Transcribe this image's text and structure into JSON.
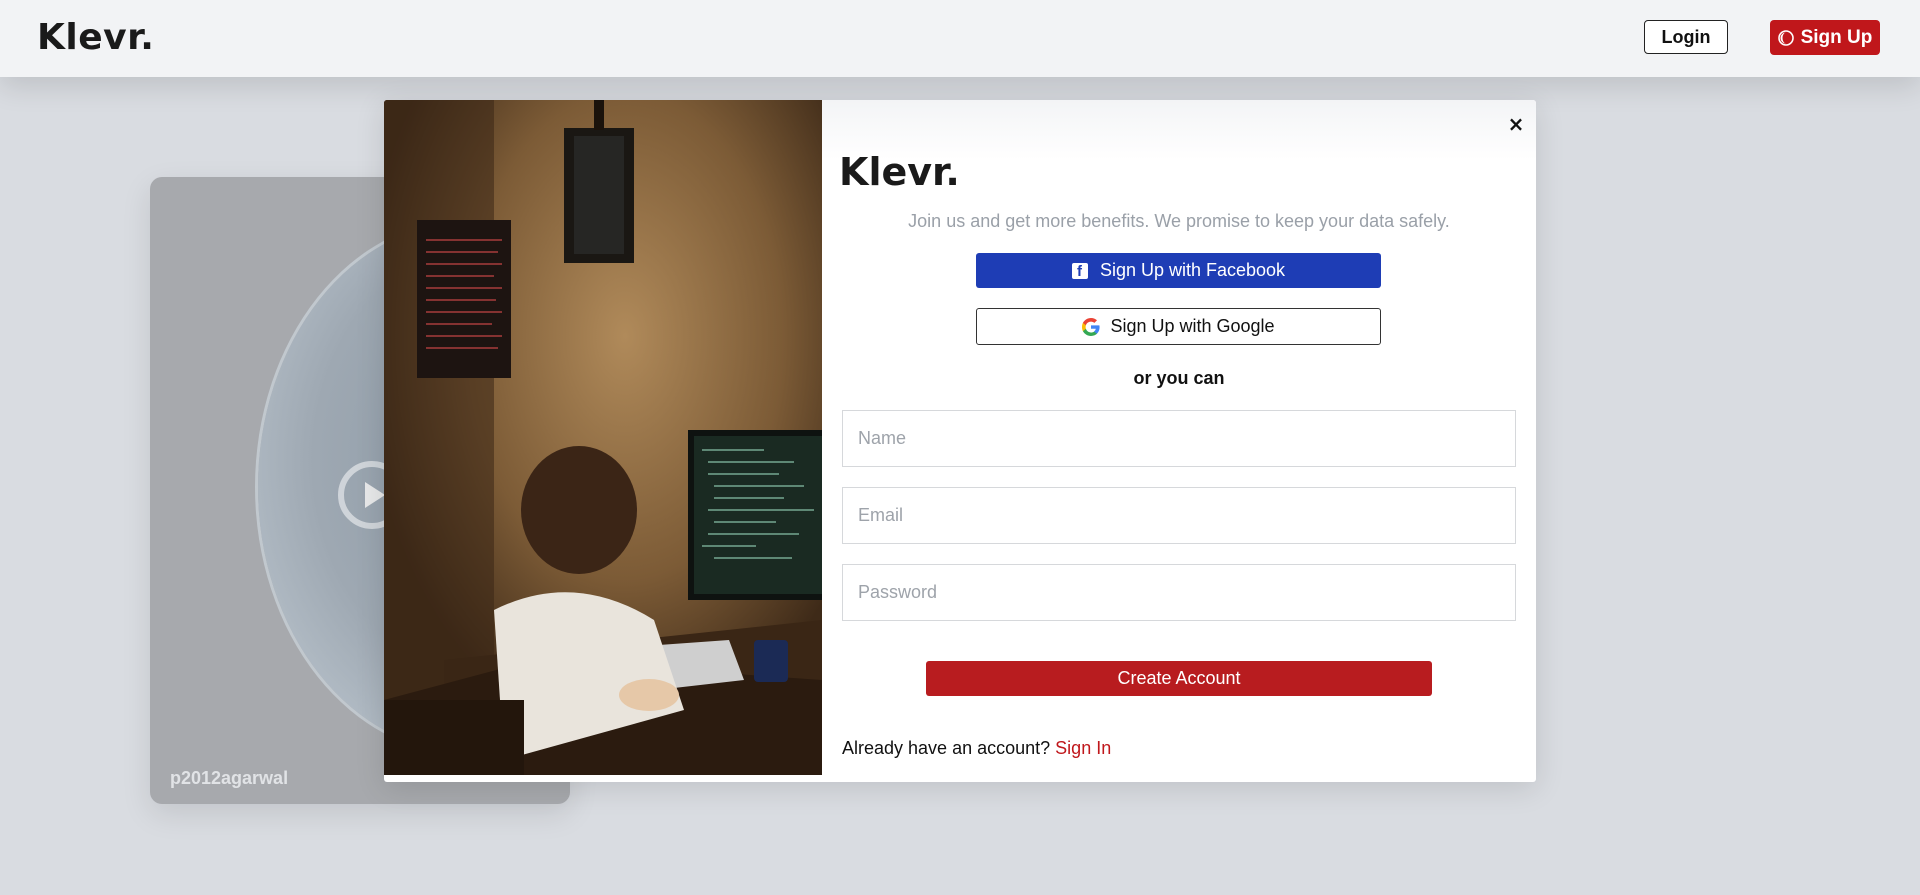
{
  "header": {
    "logo": "Klevr.",
    "login_label": "Login",
    "signup_label": "Sign Up"
  },
  "background_card": {
    "username": "p2012agarwal"
  },
  "modal": {
    "logo": "Klevr.",
    "tagline": "Join us and get more benefits. We promise to keep your data safely.",
    "facebook_label": "Sign Up with Facebook",
    "google_label": "Sign Up with Google",
    "divider_text": "or you can",
    "fields": {
      "name_placeholder": "Name",
      "email_placeholder": "Email",
      "password_placeholder": "Password"
    },
    "create_label": "Create Account",
    "already_text": "Already have an account?",
    "signin_label": "Sign In",
    "close_symbol": "×"
  },
  "colors": {
    "brand_red": "#c0171b",
    "facebook_blue": "#1e3db5",
    "overlay_bg": "#d9dce1"
  },
  "icons": [
    "moon-icon",
    "play-icon",
    "facebook-icon",
    "google-icon",
    "close-icon"
  ]
}
